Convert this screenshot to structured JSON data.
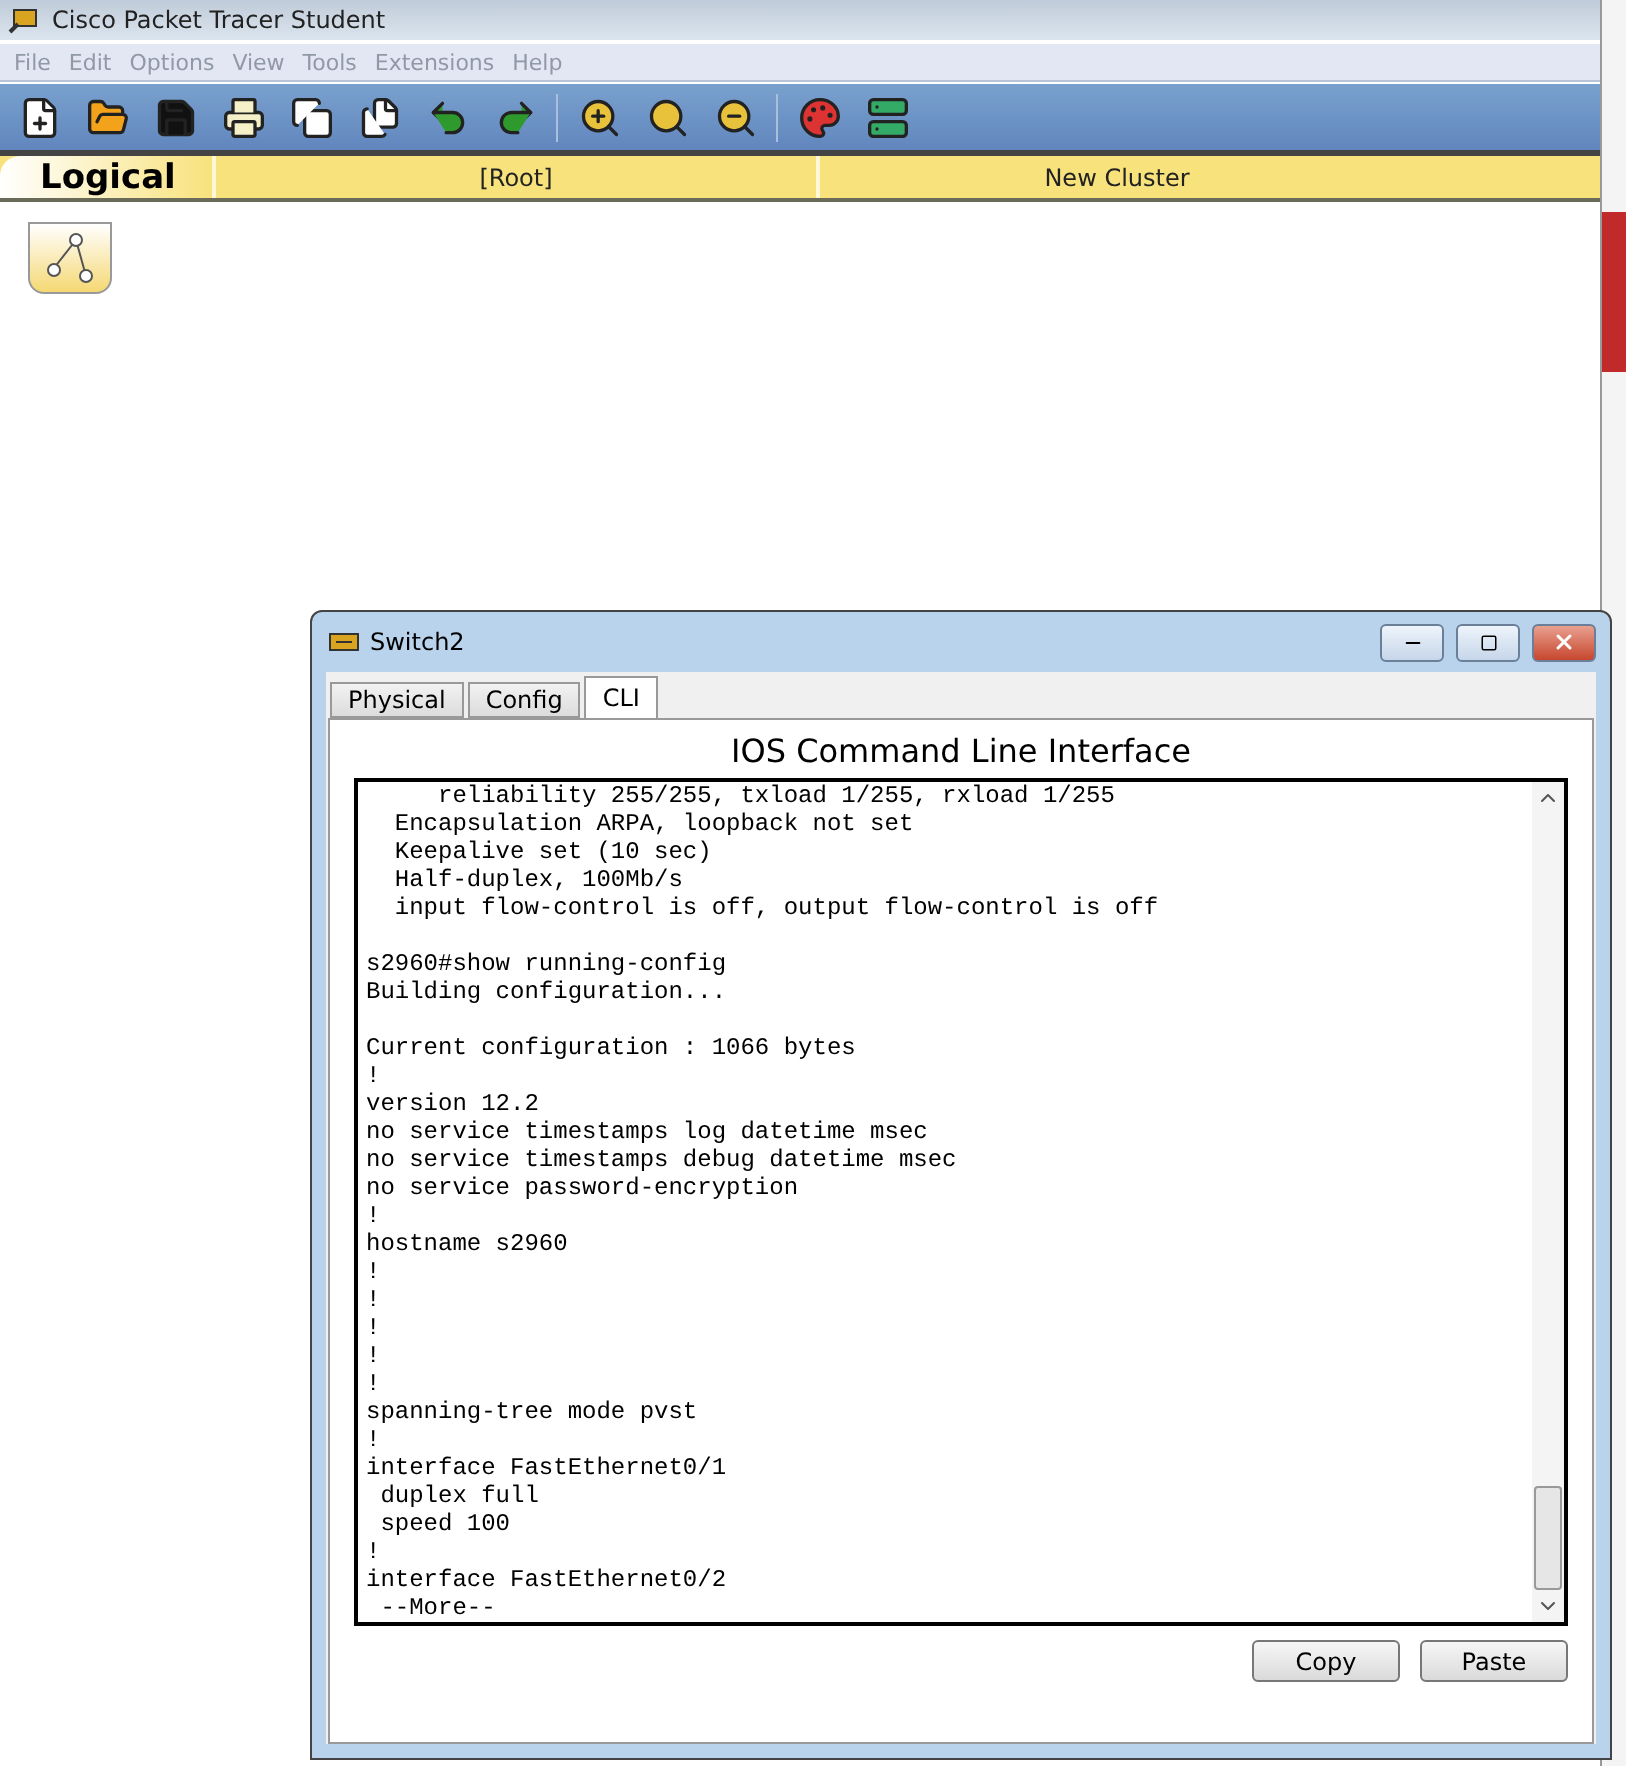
{
  "app": {
    "title": "Cisco Packet Tracer Student",
    "menu": [
      "File",
      "Edit",
      "Options",
      "View",
      "Tools",
      "Extensions",
      "Help"
    ],
    "workspace_tab": "Logical",
    "breadcrumb": [
      "[Root]",
      "New Cluster"
    ]
  },
  "dialog": {
    "title": "Switch2",
    "tabs": [
      {
        "label": "Physical",
        "selected": false
      },
      {
        "label": "Config",
        "selected": false
      },
      {
        "label": "CLI",
        "selected": true
      }
    ],
    "heading": "IOS Command Line Interface",
    "terminal": [
      [
        "     reliability 255/255, txload 1/255, rxload 1/255",
        "  Encapsulation ARPA, loopback not set",
        "  Keepalive set (10 sec)",
        "  Half-duplex, 100Mb/s",
        "  input flow-control is off, output flow-control is off"
      ],
      [
        "s2960#show running-config",
        "Building configuration..."
      ],
      [
        "Current configuration : 1066 bytes",
        "!",
        "version 12.2",
        "no service timestamps log datetime msec",
        "no service timestamps debug datetime msec",
        "no service password-encryption",
        "!",
        "hostname s2960",
        "!",
        "!",
        "!",
        "!",
        "!",
        "spanning-tree mode pvst",
        "!",
        "interface FastEthernet0/1",
        " duplex full",
        " speed 100",
        "!",
        "interface FastEthernet0/2",
        " --More-- "
      ]
    ],
    "buttons": [
      "Copy",
      "Paste"
    ]
  }
}
